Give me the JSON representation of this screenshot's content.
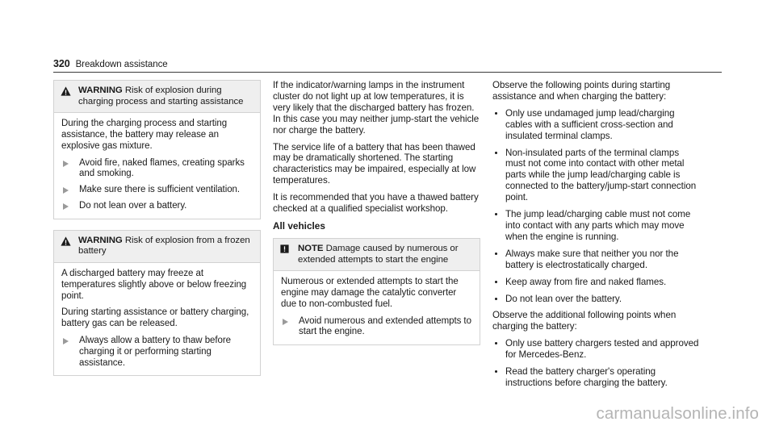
{
  "header": {
    "page_number": "320",
    "chapter": "Breakdown assistance"
  },
  "left_column": {
    "warning_1": {
      "icon": "warning-triangle-icon",
      "keyword": "WARNING",
      "title": "Risk of explosion during charging process and starting assistance",
      "paragraphs": [
        "During the charging process and starting assistance, the battery may release an explosive gas mixture."
      ],
      "actions": [
        "Avoid fire, naked flames, creating sparks and smoking.",
        "Make sure there is sufficient ventilation.",
        "Do not lean over a battery."
      ]
    },
    "warning_2": {
      "icon": "warning-triangle-icon",
      "keyword": "WARNING",
      "title": "Risk of explosion from a frozen battery",
      "paragraphs": [
        "A discharged battery may freeze at temperatures slightly above or below freezing point.",
        "During starting assistance or battery charging, battery gas can be released."
      ],
      "actions": [
        "Always allow a battery to thaw before charging it or performing starting assistance."
      ]
    }
  },
  "middle_column": {
    "paragraphs": [
      "If the indicator/warning lamps in the instrument cluster do not light up at low temperatures, it is very likely that the discharged battery has frozen. In this case you may neither jump-start the vehicle nor charge the battery.",
      "The service life of a battery that has been thawed may be dramatically shortened. The starting characteristics may be impaired, especially at low temperatures.",
      "It is recommended that you have a thawed battery checked at a qualified specialist workshop."
    ],
    "subheading": "All vehicles",
    "note": {
      "icon": "note-exclamation-icon",
      "keyword": "NOTE",
      "title": "Damage caused by numerous or extended attempts to start the engine",
      "paragraphs": [
        "Numerous or extended attempts to start the engine may damage the catalytic converter due to non-combusted fuel."
      ],
      "actions": [
        "Avoid numerous and extended attempts to start the engine."
      ]
    }
  },
  "right_column": {
    "intro_1": "Observe the following points during starting assistance and when charging the battery:",
    "bullets_1": [
      "Only use undamaged jump lead/charging cables with a sufficient cross-section and insulated terminal clamps.",
      "Non-insulated parts of the terminal clamps must not come into contact with other metal parts while the jump lead/charging cable is connected to the battery/jump-start connection point.",
      "The jump lead/charging cable must not come into contact with any parts which may move when the engine is running.",
      "Always make sure that neither you nor the battery is electrostatically charged.",
      "Keep away from fire and naked flames.",
      "Do not lean over the battery."
    ],
    "intro_2": "Observe the additional following points when charging the battery:",
    "bullets_2": [
      "Only use battery chargers tested and approved for Mercedes-Benz.",
      "Read the battery charger's operating instructions before charging the battery."
    ]
  },
  "watermark": "carmanualsonline.info",
  "colors": {
    "text": "#1a1a1a",
    "rule": "#3a3a3a",
    "box_border": "#d2d2d2",
    "box_header_bg": "#efefef",
    "action_marker": "#9a9a9a",
    "watermark": "#b4b4b4"
  }
}
